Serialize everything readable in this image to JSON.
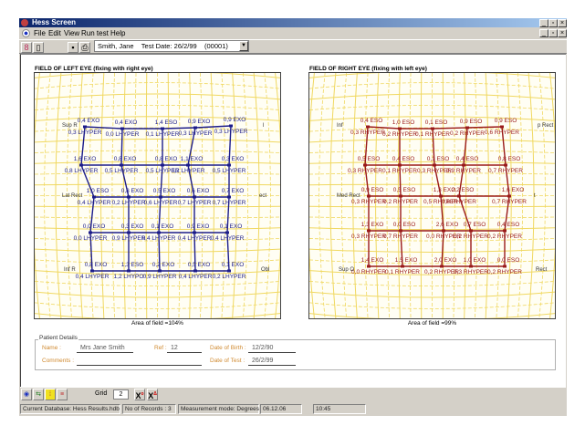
{
  "window": {
    "title": "Hess Screen"
  },
  "menu": [
    "File",
    "Edit",
    "View",
    "Run test",
    "Help"
  ],
  "toolbar": {
    "record_select": "Smith, Jane    Test Date: 26/2/99    (00001)"
  },
  "colors": {
    "left_eye": "#1c1c8a",
    "right_eye": "#9a1a1a",
    "grid": "#f0d860",
    "label_orange": "#d08a30"
  },
  "left_chart": {
    "title": "FIELD OF LEFT EYE (fixing with right eye)",
    "area": "Area of field =104%",
    "corners": [
      "Sup R",
      "l",
      "Lat Rect",
      "ect",
      "Inf R",
      "Obl"
    ],
    "top_labels": [
      [
        "0,4 EXO",
        "0,4 EXO",
        "1,4 ESO",
        "0,9 EXO",
        "0,9 EXO"
      ],
      [
        "1,6 EXO",
        "0,8 EXO",
        "0,8 EXO",
        "1,1 EXO",
        "0,3 EXO"
      ],
      [
        "1,0 ESO",
        "0,8 EXO",
        "0,5 EXO",
        "0,6 EXO",
        "0,7 EXO"
      ],
      [
        "0,0 EXO",
        "0,3 EXO",
        "0,1 EXO",
        "0,9 EXO",
        "0,1 EXO"
      ],
      [
        "0,8 EXO",
        "1,3 ESO",
        "0,2 EXO",
        "0,5 EXO",
        "0,1 EXO"
      ]
    ],
    "bottom_labels": [
      [
        "0,3 LHYPER",
        "0,0 LHYPER",
        "0,1 LHYPER",
        "0,3 LHYPER",
        "0,3 LHYPER"
      ],
      [
        "0,8 LHYPER",
        "0,5 LHYPER",
        "0,5 LHYPER",
        "0,2 LHYPER",
        "0,5 LHYPER"
      ],
      [
        "0,4 LHYPER",
        "0,2 LHYPER",
        "0,6 LHYPER",
        "0,7 LHYPER",
        "0,7 LHYPER"
      ],
      [
        "0,0 LHYPER",
        "0,9 LHYPER",
        "0,4 LHYPER",
        "0,4 LHYPER",
        "0,4 LHYPER"
      ],
      [
        "0,4 LHYPER",
        "1,2 LHYPO",
        "0,9 LHYPER",
        "0,4 LHYPER",
        "0,2 LHYPER"
      ]
    ]
  },
  "right_chart": {
    "title": "FIELD OF RIGHT EYE (fixing with left eye)",
    "area": "Area of field =99%",
    "corners": [
      "Inf",
      "p Rect",
      "Med Rect",
      "t",
      "Sup O",
      "Rect"
    ],
    "top_labels": [
      [
        "0,4 ESO",
        "1,0 ESO",
        "0,1 ESO",
        "0,9 ESO",
        "0,9 ESO"
      ],
      [
        "0,5 ESO",
        "0,4 ESO",
        "0,1 ESO",
        "0,4 ESO",
        "0,8 ESO"
      ],
      [
        "0,9 ESO",
        "0,5 ESO",
        "1,3 EXO",
        "2,2 ESO",
        "1,6 EXO"
      ],
      [
        "1,3 EXO",
        "0,0 ESO",
        "2,6 EXO",
        "0,7 ESO",
        "0,4 ESO"
      ],
      [
        "1,4 EXO",
        "1,5 EXO",
        "2,0 EXO",
        "1,0 EXO",
        "0,0 ESO"
      ]
    ],
    "bottom_labels": [
      [
        "0,3 RHYPER",
        "0,2 RHYPER",
        "0,1 RHYPER",
        "0,2 RHYPER",
        "0,6 RHYPER"
      ],
      [
        "0,3 RHYPER",
        "0,1 RHYPER",
        "0,3 RHYPER",
        "0,9 RHYPER",
        "0,7 RHYPER"
      ],
      [
        "0,3 RHYPER",
        "0,2 RHYPER",
        "0,5 RHYPER",
        "0,6 RHYPER",
        "0,7 RHYPER"
      ],
      [
        "0,3 RHYPER",
        "0,7 RHYPER",
        "0,0 RHYPER",
        "0,2 RHYPER",
        "0,2 RHYPER"
      ],
      [
        "0,0 RHYPER",
        "0,1 RHYPER",
        "0,2 RHYPER",
        "0,3 RHYPER",
        "0,2 RHYPER"
      ]
    ]
  },
  "patient": {
    "legend": "Patient Details",
    "name_label": "Name :",
    "name": "Mrs Jane Smith",
    "ref_label": "Ref :",
    "ref": "12",
    "dob_label": "Date of Birth :",
    "dob": "12/2/90",
    "comments_label": "Comments :",
    "comments": "",
    "dot_label": "Date of Test :",
    "dot": "26/2/99"
  },
  "bottom": {
    "grid_label": "Grid",
    "grid_value": "2"
  },
  "status": [
    "Current Database: Hess Results.hdb",
    "No of Records :  3",
    "Measurement mode: Degrees",
    "06.12.06",
    "10:45"
  ]
}
